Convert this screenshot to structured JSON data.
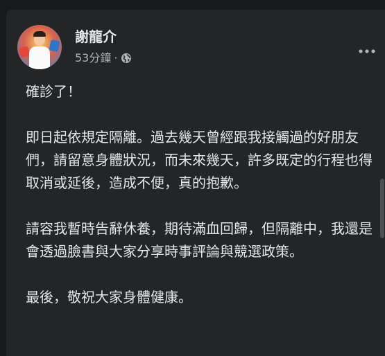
{
  "post": {
    "author": "謝龍介",
    "time": "53分鐘",
    "separator": "·",
    "paragraphs": [
      "確診了！",
      "即日起依規定隔離。過去幾天曾經跟我接觸過的好朋友們，請留意身體狀況，而未來幾天，許多既定的行程也得取消或延後，造成不便，真的抱歉。",
      "請容我暫時告辭休養，期待滿血回歸，但隔離中，我還是會透過臉書與大家分享時事評論與競選政策。",
      "最後，敬祝大家身體健康。"
    ]
  },
  "icons": {
    "avatar": "profile-photo",
    "privacy": "globe-icon",
    "menu": "more-horizontal-icon"
  },
  "colors": {
    "background": "#18191a",
    "card": "#242526",
    "text_primary": "#e4e6eb",
    "text_secondary": "#b0b3b8"
  }
}
